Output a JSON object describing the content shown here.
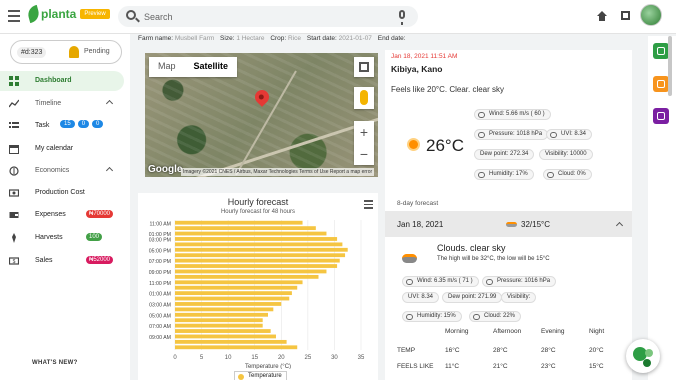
{
  "app": {
    "name": "planta",
    "badge": "Preview"
  },
  "search": {
    "placeholder": "Search"
  },
  "farm_selector": {
    "id": "#d:323",
    "status": "Pending"
  },
  "sidebar": {
    "items": [
      {
        "label": "Dashboard"
      },
      {
        "label": "Timeline"
      },
      {
        "label": "Task",
        "counts": [
          "15",
          "0",
          "0"
        ]
      },
      {
        "label": "My calendar"
      },
      {
        "label": "Economics"
      },
      {
        "label": "Production Cost"
      },
      {
        "label": "Expenses",
        "badge": "₦70000",
        "badge_color": "#e53935"
      },
      {
        "label": "Harvests",
        "badge": "100",
        "badge_color": "#43a047"
      },
      {
        "label": "Sales",
        "badge": "₦52000",
        "badge_color": "#d81b60"
      }
    ],
    "whats_new": "WHAT'S NEW?"
  },
  "farm_info": {
    "name_label": "Farm name:",
    "name": "Musbell Farm",
    "size_label": "Size:",
    "size": "1 Hectare",
    "crop_label": "Crop:",
    "crop": "Rice",
    "start_label": "Start date:",
    "start": "2021-01-07",
    "end_label": "End date:",
    "end": ""
  },
  "map": {
    "tab_map": "Map",
    "tab_satellite": "Satellite",
    "zoom_in": "+",
    "zoom_out": "−",
    "logo": "Google",
    "attribution": "Imagery ©2021 CNES / Airbus, Maxar Technologies   Terms of Use   Report a map error"
  },
  "weather_now": {
    "datetime": "Jan 18, 2021 11:51 AM",
    "location": "Kibiya, Kano",
    "feels": "Feels like 20°C. Clear. clear sky",
    "temp": "26°C",
    "wind": "Wind: 5.66 m/s ( 60 )",
    "pressure": "Pressure: 1018 hPa",
    "uvi": "UVI: 8.34",
    "dew": "Dew point: 272.34",
    "visibility": "Visibility: 10000",
    "humidity": "Humidity: 17%",
    "cloud": "Cloud: 0%"
  },
  "chart_data": {
    "type": "bar",
    "orientation": "horizontal",
    "title": "Hourly forecast",
    "subtitle": "Hourly forecast for 48 hours",
    "xlabel": "Temperature (°C)",
    "xlim": [
      0,
      35
    ],
    "xticks": [
      0,
      5,
      10,
      15,
      20,
      25,
      30,
      35
    ],
    "legend": "Temperature",
    "color": "#f5c542",
    "categories": [
      "11:00 AM",
      "",
      "01:00 PM",
      "03:00 PM",
      "",
      "05:00 PM",
      "",
      "07:00 PM",
      "",
      "09:00 PM",
      "",
      "11:00 PM",
      "",
      "01:00 AM",
      "",
      "03:00 AM",
      "",
      "05:00 AM",
      "",
      "07:00 AM",
      "",
      "09:00 AM"
    ],
    "values": [
      24,
      26.5,
      28.5,
      30.5,
      31.5,
      32.5,
      32,
      31,
      30.5,
      28.5,
      27,
      24,
      23,
      22,
      21.5,
      20,
      18.5,
      17.5,
      16.5,
      16.5,
      18,
      19,
      21,
      23
    ]
  },
  "daily": {
    "title": "8-day forecast",
    "date": "Jan 18, 2021",
    "temps": "32/15°C",
    "desc": "Clouds. clear sky",
    "note": "The high will be 32°C, the low will be 15°C",
    "wind": "Wind: 6.35 m/s ( 71 )",
    "pressure": "Pressure: 1016 hPa",
    "uvi": "UVI: 8.34",
    "dew": "Dew point: 271.99",
    "visibility": "Visibility:",
    "humidity": "Humidity: 15%",
    "cloud": "Cloud: 22%",
    "columns": [
      "",
      "Morning",
      "Afternoon",
      "Evening",
      "Night"
    ],
    "rows": [
      [
        "TEMP",
        "16°C",
        "28°C",
        "28°C",
        "20°C"
      ],
      [
        "FEELS LIKE",
        "11°C",
        "21°C",
        "23°C",
        "15°C"
      ]
    ]
  },
  "icons": [
    "menu-icon",
    "search-icon",
    "mic-icon",
    "home-icon",
    "fullscreen-icon",
    "dashboard-icon",
    "timeline-icon",
    "task-icon",
    "calendar-icon",
    "economics-icon",
    "production-cost-icon",
    "expenses-icon",
    "harvests-icon",
    "sales-icon",
    "sun-icon",
    "cloud-icon"
  ],
  "colors": {
    "brand": "#3aa541",
    "accent_red": "#e53935",
    "chart_bar": "#f5c542"
  }
}
